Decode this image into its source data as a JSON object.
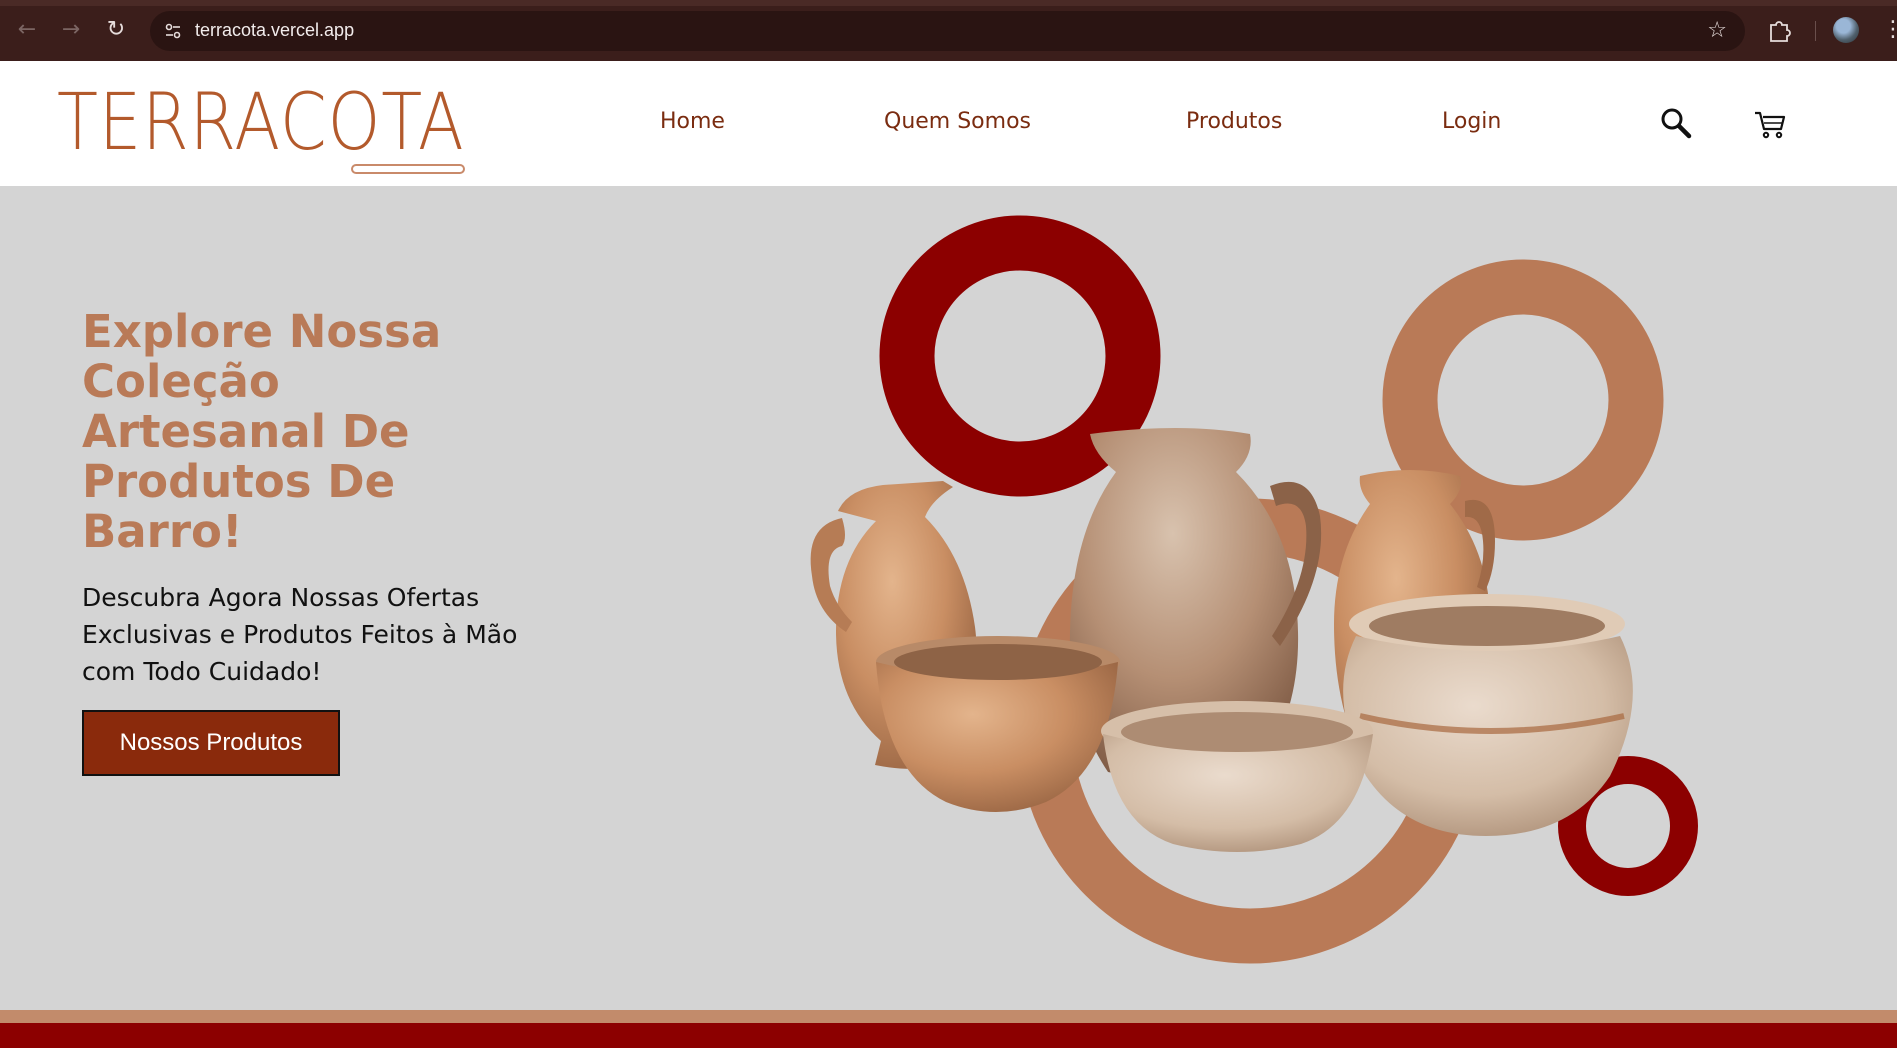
{
  "browser": {
    "url": "terracota.vercel.app",
    "back_icon": "back-arrow-icon",
    "forward_icon": "forward-arrow-icon",
    "reload_icon": "reload-icon",
    "site_info_icon": "site-info-icon",
    "bookmark_icon": "star-icon",
    "extensions_icon": "extensions-icon",
    "profile_icon": "profile-avatar",
    "menu_icon": "more-vertical-icon"
  },
  "header": {
    "logo": "TERRACOTA",
    "nav": {
      "home": "Home",
      "about": "Quem Somos",
      "products": "Produtos",
      "login": "Login"
    },
    "search_icon": "search-icon",
    "cart_icon": "cart-icon"
  },
  "hero": {
    "title": "Explore Nossa Coleção Artesanal De Produtos De Barro!",
    "subtitle": "Descubra Agora Nossas Ofertas Exclusivas e Produtos Feitos à Mão com Todo Cuidado!",
    "button": "Nossos Produtos"
  },
  "colors": {
    "brand": "#b35a2c",
    "dark_red": "#8c0000",
    "tan": "#b97a57",
    "button": "#8a2a0c",
    "nav_text": "#7a2c10",
    "hero_bg": "#d4d4d4"
  }
}
